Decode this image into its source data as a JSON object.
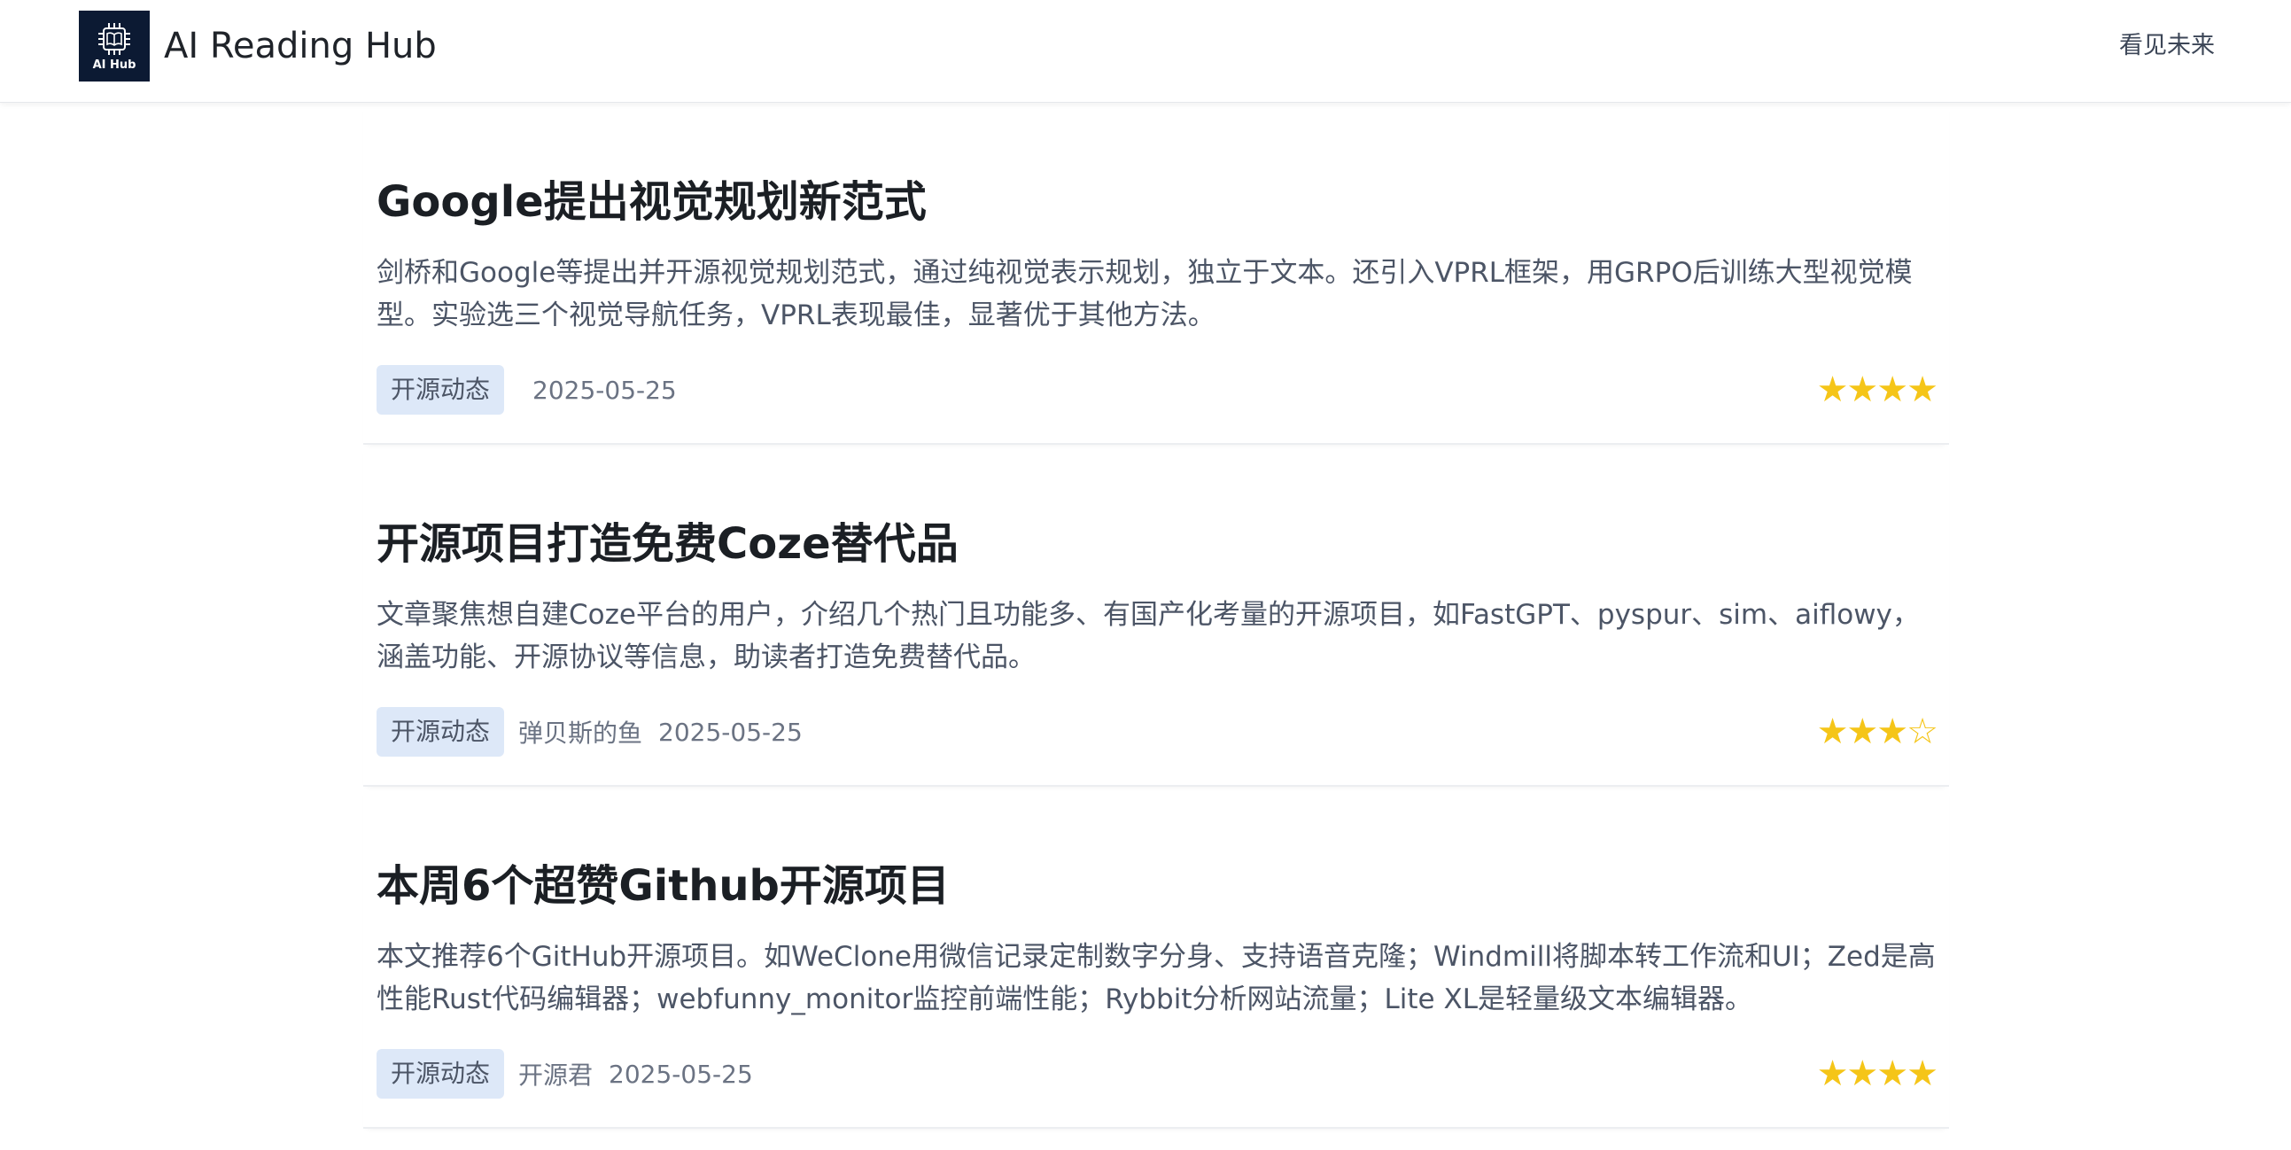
{
  "header": {
    "logo_text": "AI Hub",
    "brand": "AI Reading Hub",
    "nav_link": "看见未来"
  },
  "articles": [
    {
      "title": "Google提出视觉规划新范式",
      "summary": "剑桥和Google等提出并开源视觉规划范式，通过纯视觉表示规划，独立于文本。还引入VPRL框架，用GRPO后训练大型视觉模型。实验选三个视觉导航任务，VPRL表现最佳，显著优于其他方法。",
      "tag": "开源动态",
      "author": "",
      "date": "2025-05-25",
      "stars": "★★★★",
      "rating": 4
    },
    {
      "title": "开源项目打造免费Coze替代品",
      "summary": "文章聚焦想自建Coze平台的用户，介绍几个热门且功能多、有国产化考量的开源项目，如FastGPT、pyspur、sim、aiflowy，涵盖功能、开源协议等信息，助读者打造免费替代品。",
      "tag": "开源动态",
      "author": "弹贝斯的鱼",
      "date": "2025-05-25",
      "stars": "★★★☆",
      "rating": 3
    },
    {
      "title": "本周6个超赞Github开源项目",
      "summary": "本文推荐6个GitHub开源项目。如WeClone用微信记录定制数字分身、支持语音克隆；Windmill将脚本转工作流和UI；Zed是高性能Rust代码编辑器；webfunny_monitor监控前端性能；Rybbit分析网站流量；Lite XL是轻量级文本编辑器。",
      "tag": "开源动态",
      "author": "开源君",
      "date": "2025-05-25",
      "stars": "★★★★",
      "rating": 4
    }
  ],
  "colors": {
    "logo_bg": "#0c1a33",
    "tag_bg": "#dde8f8",
    "star": "#f5c518"
  }
}
